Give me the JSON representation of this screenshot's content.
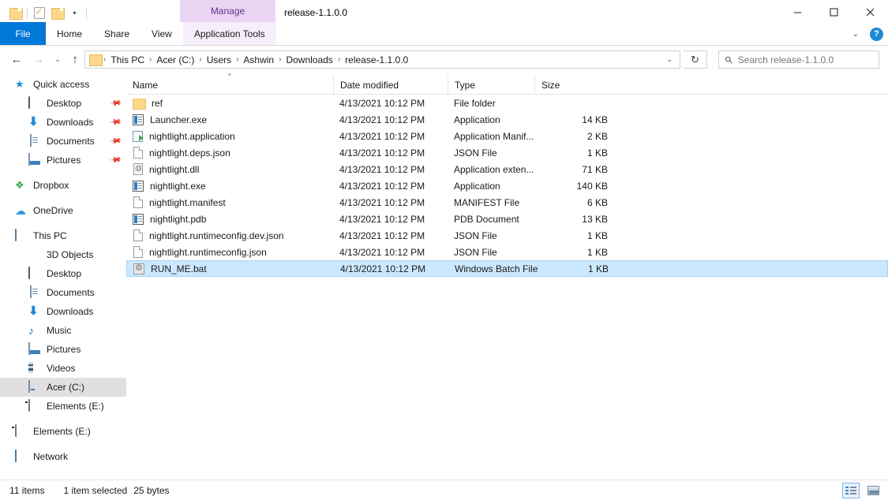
{
  "window": {
    "title": "release-1.1.0.0",
    "contextual_group": "Manage",
    "minimize_icon": "minimize-icon",
    "maximize_icon": "maximize-icon",
    "close_icon": "close-icon"
  },
  "quick_access_toolbar": {
    "items": [
      {
        "icon": "folder-icon",
        "name": "folder-button"
      },
      {
        "icon": "properties-icon",
        "name": "properties-button"
      },
      {
        "icon": "new-folder-icon",
        "name": "new-folder-button"
      }
    ],
    "dropdown_caret": "▾"
  },
  "ribbon": {
    "tabs": [
      {
        "label": "File",
        "type": "file"
      },
      {
        "label": "Home",
        "type": "normal"
      },
      {
        "label": "Share",
        "type": "normal"
      },
      {
        "label": "View",
        "type": "normal"
      },
      {
        "label": "Application Tools",
        "type": "contextual"
      }
    ],
    "expand_caret": "⌄",
    "help_label": "?",
    "accent_color": "#0078d7",
    "contextual_color": "#e9d5f2",
    "contextual_text_color": "#6b2e8f"
  },
  "address_bar": {
    "back_icon": "←",
    "forward_icon": "→",
    "recent_icon": "⌄",
    "up_icon": "↑",
    "breadcrumbs": [
      "This PC",
      "Acer (C:)",
      "Users",
      "Ashwin",
      "Downloads",
      "release-1.1.0.0"
    ],
    "separator": "›",
    "dropdown_caret": "⌄",
    "refresh_icon": "↻"
  },
  "search": {
    "placeholder": "Search release-1.1.0.0",
    "icon": "search-icon"
  },
  "sidebar": {
    "items": [
      {
        "label": "Quick access",
        "icon": "star-icon",
        "level": 0,
        "pinned": false,
        "selected": false
      },
      {
        "label": "Desktop",
        "icon": "desktop-icon",
        "level": 1,
        "pinned": true,
        "selected": false
      },
      {
        "label": "Downloads",
        "icon": "download-icon",
        "level": 1,
        "pinned": true,
        "selected": false
      },
      {
        "label": "Documents",
        "icon": "documents-icon",
        "level": 1,
        "pinned": true,
        "selected": false
      },
      {
        "label": "Pictures",
        "icon": "pictures-icon",
        "level": 1,
        "pinned": true,
        "selected": false
      },
      {
        "label": "Dropbox",
        "icon": "dropbox-icon",
        "level": 0,
        "pinned": false,
        "selected": false
      },
      {
        "label": "OneDrive",
        "icon": "onedrive-icon",
        "level": 0,
        "pinned": false,
        "selected": false
      },
      {
        "label": "This PC",
        "icon": "this-pc-icon",
        "level": 0,
        "pinned": false,
        "selected": false
      },
      {
        "label": "3D Objects",
        "icon": "3d-objects-icon",
        "level": 1,
        "pinned": false,
        "selected": false
      },
      {
        "label": "Desktop",
        "icon": "desktop-icon",
        "level": 1,
        "pinned": false,
        "selected": false
      },
      {
        "label": "Documents",
        "icon": "documents-icon",
        "level": 1,
        "pinned": false,
        "selected": false
      },
      {
        "label": "Downloads",
        "icon": "download-icon",
        "level": 1,
        "pinned": false,
        "selected": false
      },
      {
        "label": "Music",
        "icon": "music-icon",
        "level": 1,
        "pinned": false,
        "selected": false
      },
      {
        "label": "Pictures",
        "icon": "pictures-icon",
        "level": 1,
        "pinned": false,
        "selected": false
      },
      {
        "label": "Videos",
        "icon": "videos-icon",
        "level": 1,
        "pinned": false,
        "selected": false
      },
      {
        "label": "Acer (C:)",
        "icon": "drive-icon",
        "level": 1,
        "pinned": false,
        "selected": true
      },
      {
        "label": "Elements (E:)",
        "icon": "external-drive-icon",
        "level": 1,
        "pinned": false,
        "selected": false
      },
      {
        "label": "Elements (E:)",
        "icon": "external-drive-icon",
        "level": 0,
        "pinned": false,
        "selected": false
      },
      {
        "label": "Network",
        "icon": "network-icon",
        "level": 0,
        "pinned": false,
        "selected": false
      }
    ]
  },
  "file_list": {
    "columns": [
      {
        "label": "Name",
        "sorted": true,
        "sort_arrow": "⌃"
      },
      {
        "label": "Date modified",
        "sorted": false
      },
      {
        "label": "Type",
        "sorted": false
      },
      {
        "label": "Size",
        "sorted": false
      }
    ],
    "rows": [
      {
        "name": "ref",
        "date": "4/13/2021 10:12 PM",
        "type": "File folder",
        "size": "",
        "icon": "folder-icon",
        "selected": false
      },
      {
        "name": "Launcher.exe",
        "date": "4/13/2021 10:12 PM",
        "type": "Application",
        "size": "14 KB",
        "icon": "application-icon",
        "selected": false
      },
      {
        "name": "nightlight.application",
        "date": "4/13/2021 10:12 PM",
        "type": "Application Manif...",
        "size": "2 KB",
        "icon": "manifest-icon",
        "selected": false
      },
      {
        "name": "nightlight.deps.json",
        "date": "4/13/2021 10:12 PM",
        "type": "JSON File",
        "size": "1 KB",
        "icon": "document-icon",
        "selected": false
      },
      {
        "name": "nightlight.dll",
        "date": "4/13/2021 10:12 PM",
        "type": "Application exten...",
        "size": "71 KB",
        "icon": "dll-icon",
        "selected": false
      },
      {
        "name": "nightlight.exe",
        "date": "4/13/2021 10:12 PM",
        "type": "Application",
        "size": "140 KB",
        "icon": "application-icon",
        "selected": false
      },
      {
        "name": "nightlight.manifest",
        "date": "4/13/2021 10:12 PM",
        "type": "MANIFEST File",
        "size": "6 KB",
        "icon": "document-icon",
        "selected": false
      },
      {
        "name": "nightlight.pdb",
        "date": "4/13/2021 10:12 PM",
        "type": "PDB Document",
        "size": "13 KB",
        "icon": "application-icon",
        "selected": false
      },
      {
        "name": "nightlight.runtimeconfig.dev.json",
        "date": "4/13/2021 10:12 PM",
        "type": "JSON File",
        "size": "1 KB",
        "icon": "document-icon",
        "selected": false
      },
      {
        "name": "nightlight.runtimeconfig.json",
        "date": "4/13/2021 10:12 PM",
        "type": "JSON File",
        "size": "1 KB",
        "icon": "document-icon",
        "selected": false
      },
      {
        "name": "RUN_ME.bat",
        "date": "4/13/2021 10:12 PM",
        "type": "Windows Batch File",
        "size": "1 KB",
        "icon": "batch-file-icon",
        "selected": true
      }
    ],
    "selection_color": "#cce8ff"
  },
  "status_bar": {
    "item_count": "11 items",
    "selection_count": "1 item selected",
    "selection_size": "25 bytes",
    "views": [
      {
        "name": "details-view",
        "active": true
      },
      {
        "name": "large-icons-view",
        "active": false
      }
    ]
  }
}
